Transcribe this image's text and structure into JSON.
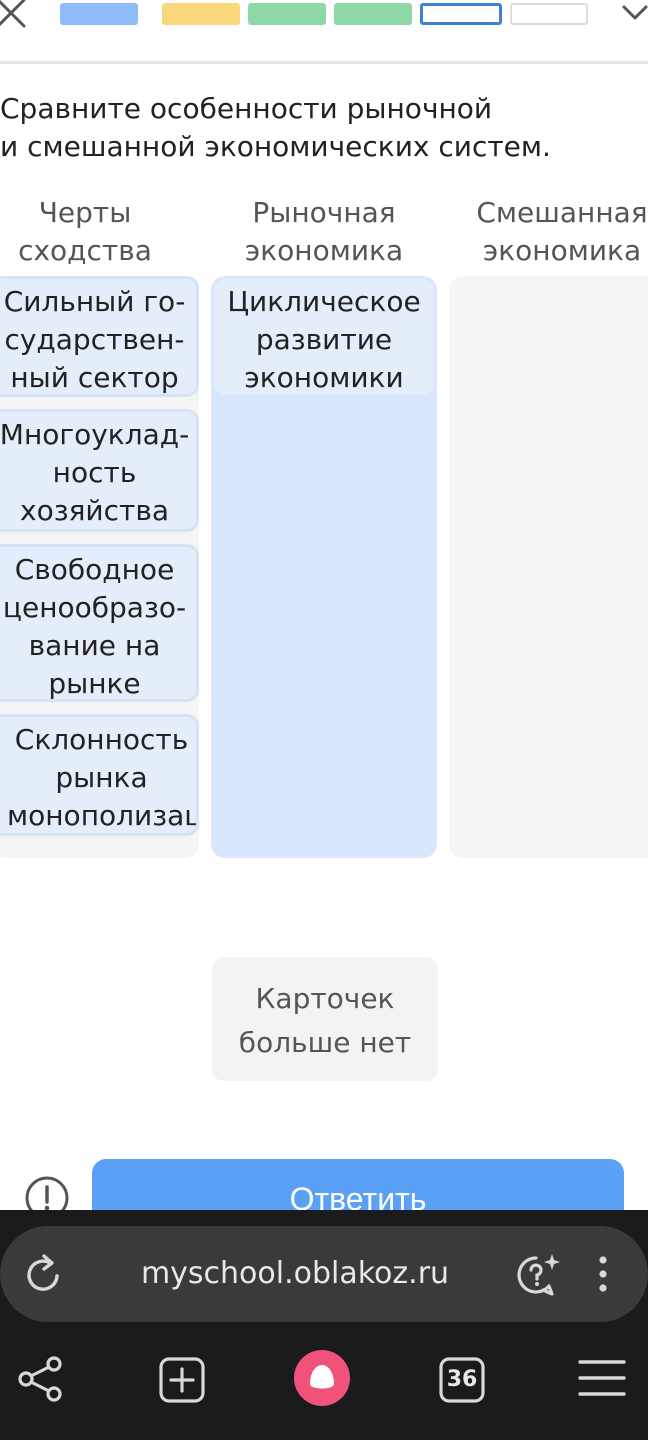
{
  "progress": {
    "segments": [
      {
        "state": "done-blue",
        "fill": "#8fbcf8",
        "border": "#8fbcf8"
      },
      {
        "state": "done-yellow",
        "fill": "#f9d77a",
        "border": "#f9d77a"
      },
      {
        "state": "done-green",
        "fill": "#8ed7a6",
        "border": "#8ed7a6"
      },
      {
        "state": "done-green",
        "fill": "#8ed7a6",
        "border": "#8ed7a6"
      },
      {
        "state": "current",
        "fill": "#ffffff",
        "border": "#3b82d8"
      },
      {
        "state": "pending",
        "fill": "#ffffff",
        "border": "#dcdcdc"
      }
    ]
  },
  "question": "Сравните особенности рыночной\nи смешанной экономических систем.",
  "columns": {
    "similar": {
      "header": "Черты\nсходства",
      "cards": [
        "Сильный го-\nсударствен-\nный сектор",
        "Многоуклад-\nность\nхозяйства",
        "Свободное\nценообразо-\nвание на\nрынке",
        "Склонность\nрынка\nмонополизации"
      ]
    },
    "market": {
      "header": "Рыночная\nэкономика",
      "cards": [
        "Циклическое\nразвитие\nэкономики"
      ]
    },
    "mixed": {
      "header": "Смешанная\nэкономика",
      "cards": []
    }
  },
  "empty_message": "Карточек\nбольше нет",
  "answer_button": "Ответить",
  "browser": {
    "url": "myschool.oblakoz.ru",
    "tab_count": "36"
  },
  "colors": {
    "accent_blue": "#5aa0f5",
    "card_bg": "#e4eefb",
    "market_column_bg": "#d8e7fd",
    "neutral_column_bg": "#f5f5f5",
    "alice_pink": "#f0527a"
  }
}
